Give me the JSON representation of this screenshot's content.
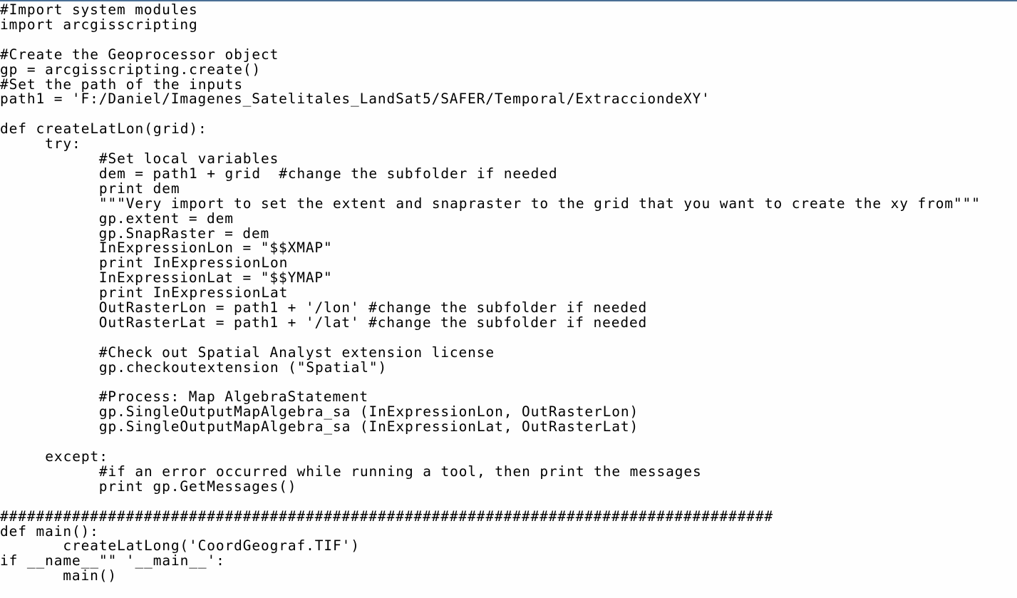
{
  "editor": {
    "language": "python",
    "lines": [
      "#Import system modules",
      "import arcgisscripting",
      "",
      "#Create the Geoprocessor object",
      "gp = arcgisscripting.create()",
      "#Set the path of the inputs",
      "path1 = 'F:/Daniel/Imagenes_Satelitales_LandSat5/SAFER/Temporal/ExtracciondeXY'",
      "",
      "def createLatLon(grid):",
      "     try:",
      "           #Set local variables",
      "           dem = path1 + grid  #change the subfolder if needed",
      "           print dem",
      "           \"\"\"Very import to set the extent and snapraster to the grid that you want to create the xy from\"\"\"",
      "           gp.extent = dem",
      "           gp.SnapRaster = dem",
      "           InExpressionLon = \"$$XMAP\"",
      "           print InExpressionLon",
      "           InExpressionLat = \"$$YMAP\"",
      "           print InExpressionLat",
      "           OutRasterLon = path1 + '/lon' #change the subfolder if needed",
      "           OutRasterLat = path1 + '/lat' #change the subfolder if needed",
      "",
      "           #Check out Spatial Analyst extension license",
      "           gp.checkoutextension (\"Spatial\")",
      "",
      "           #Process: Map AlgebraStatement",
      "           gp.SingleOutputMapAlgebra_sa (InExpressionLon, OutRasterLon)",
      "           gp.SingleOutputMapAlgebra_sa (InExpressionLat, OutRasterLat)",
      "",
      "     except:",
      "           #if an error occurred while running a tool, then print the messages",
      "           print gp.GetMessages()",
      "",
      "######################################################################################",
      "def main():",
      "       createLatLong('CoordGeograf.TIF')",
      "if __name__\"\" '__main__':",
      "       main()"
    ]
  }
}
